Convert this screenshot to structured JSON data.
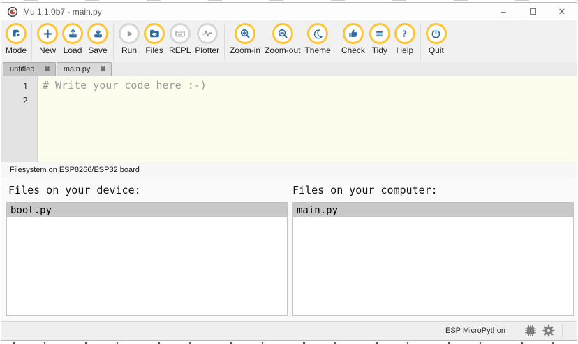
{
  "window": {
    "title": "Mu 1.1.0b7 - main.py",
    "controls": {
      "minimize": "–",
      "close": "✕"
    }
  },
  "icons": {
    "tab_close": "✖",
    "app_logo": "mu-logo",
    "statusbar": [
      "chip-icon",
      "gear-icon"
    ]
  },
  "colors": {
    "accent_yellow": "#fdc639",
    "icon_blue": "#2E6C9E",
    "disabled_gray": "#9b9b9b",
    "editor_bg": "#fdfdee",
    "selected_row": "#c8c8c8"
  },
  "toolbar": {
    "buttons": [
      {
        "label": "Mode",
        "icon": "mu-mode-icon",
        "enabled": true
      },
      {
        "label": "New",
        "icon": "plus-icon",
        "enabled": true
      },
      {
        "label": "Load",
        "icon": "upload-icon",
        "enabled": true
      },
      {
        "label": "Save",
        "icon": "download-icon",
        "enabled": true
      },
      {
        "label": "Run",
        "icon": "play-icon",
        "enabled": false
      },
      {
        "label": "Files",
        "icon": "folder-icon",
        "enabled": true
      },
      {
        "label": "REPL",
        "icon": "keyboard-icon",
        "enabled": false
      },
      {
        "label": "Plotter",
        "icon": "waveform-icon",
        "enabled": false
      },
      {
        "label": "Zoom-in",
        "icon": "zoom-in-icon",
        "enabled": true
      },
      {
        "label": "Zoom-out",
        "icon": "zoom-out-icon",
        "enabled": true
      },
      {
        "label": "Theme",
        "icon": "moon-icon",
        "enabled": true
      },
      {
        "label": "Check",
        "icon": "thumbs-up-icon",
        "enabled": true
      },
      {
        "label": "Tidy",
        "icon": "lines-icon",
        "enabled": true
      },
      {
        "label": "Help",
        "icon": "question-icon",
        "enabled": true
      },
      {
        "label": "Quit",
        "icon": "power-icon",
        "enabled": true
      }
    ]
  },
  "tabs": [
    {
      "label": "untitled",
      "active": false
    },
    {
      "label": "main.py",
      "active": true
    }
  ],
  "editor": {
    "lines": [
      {
        "number": "1",
        "code": "# Write your code here :-)"
      },
      {
        "number": "2",
        "code": ""
      }
    ]
  },
  "filesystem": {
    "header": "Filesystem on ESP8266/ESP32 board",
    "device_panel": {
      "title": "Files on your device:",
      "files": [
        {
          "name": "boot.py",
          "selected": true
        }
      ]
    },
    "computer_panel": {
      "title": "Files on your computer:",
      "files": [
        {
          "name": "main.py",
          "selected": true
        }
      ]
    }
  },
  "statusbar": {
    "mode_label": "ESP MicroPython"
  }
}
